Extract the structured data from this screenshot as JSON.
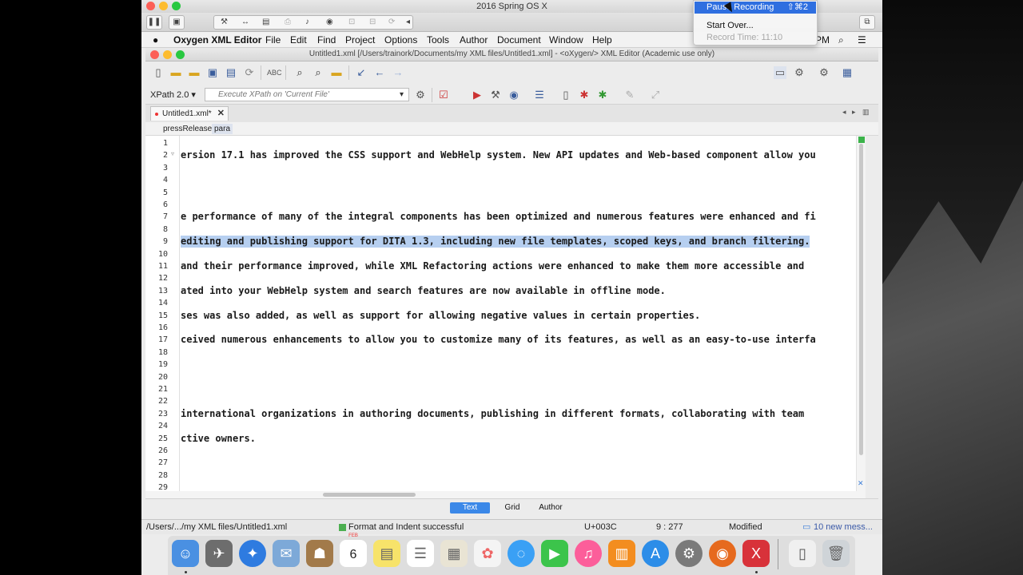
{
  "vm": {
    "title": "2016 Spring OS X"
  },
  "menubar": {
    "app": "Oxygen XML Editor",
    "items": [
      "File",
      "Edit",
      "Find",
      "Project",
      "Options",
      "Tools",
      "Author",
      "Document",
      "Window",
      "Help"
    ],
    "clock": "PM"
  },
  "window": {
    "title": "Untitled1.xml [/Users/trainork/Documents/my XML files/Untitled1.xml] - <oXygen/> XML Editor (Academic use only)"
  },
  "xpath": {
    "version": "XPath 2.0",
    "placeholder": "Execute XPath on  'Current File'"
  },
  "tab": {
    "label": "Untitled1.xml*"
  },
  "breadcrumb": [
    "pressRelease",
    "para"
  ],
  "editor": {
    "lines": [
      {
        "n": "1",
        "text": ""
      },
      {
        "n": "2",
        "text": "ersion 17.1 has improved the CSS support and WebHelp system. New API updates and Web-based component allow you"
      },
      {
        "n": "3",
        "text": ""
      },
      {
        "n": "4",
        "text": ""
      },
      {
        "n": "5",
        "text": ""
      },
      {
        "n": "6",
        "text": ""
      },
      {
        "n": "7",
        "text": "e performance of many of the integral components has been optimized and numerous features were enhanced and fi"
      },
      {
        "n": "8",
        "text": ""
      },
      {
        "n": "9",
        "text": " editing and publishing support for DITA 1.3, including new file templates, scoped keys, and branch filtering."
      },
      {
        "n": "10",
        "text": ""
      },
      {
        "n": "11",
        "text": " and their performance improved, while XML Refactoring actions were enhanced to make them more accessible and"
      },
      {
        "n": "12",
        "text": ""
      },
      {
        "n": "13",
        "text": "ated into your WebHelp system and search features are now available in offline mode."
      },
      {
        "n": "14",
        "text": ""
      },
      {
        "n": "15",
        "text": "ses was also added, as well as support for allowing negative values in certain properties."
      },
      {
        "n": "16",
        "text": ""
      },
      {
        "n": "17",
        "text": "ceived numerous enhancements to allow you to customize many of its features, as well as an easy-to-use interfa"
      },
      {
        "n": "18",
        "text": ""
      },
      {
        "n": "19",
        "text": ""
      },
      {
        "n": "20",
        "text": ""
      },
      {
        "n": "21",
        "text": ""
      },
      {
        "n": "22",
        "text": ""
      },
      {
        "n": "23",
        "text": " international organizations in authoring documents, publishing in different formats, collaborating with team"
      },
      {
        "n": "24",
        "text": ""
      },
      {
        "n": "25",
        "text": "ctive owners."
      },
      {
        "n": "26",
        "text": ""
      },
      {
        "n": "27",
        "text": ""
      },
      {
        "n": "28",
        "text": ""
      },
      {
        "n": "29",
        "text": ""
      }
    ]
  },
  "modes": [
    "Text",
    "Grid",
    "Author"
  ],
  "status": {
    "path": "/Users/.../my XML files/Untitled1.xml",
    "message": "Format and Indent successful",
    "unicode": "U+003C",
    "position": "9 : 277",
    "state": "Modified",
    "messages": "10 new mess..."
  },
  "recording": {
    "pause": "Pause Recording",
    "pause_shortcut": "⇧⌘2",
    "start_over": "Start Over...",
    "time": "Record Time: 11:10"
  },
  "dock": {
    "calendar_month": "FEB",
    "calendar_day": "6"
  }
}
